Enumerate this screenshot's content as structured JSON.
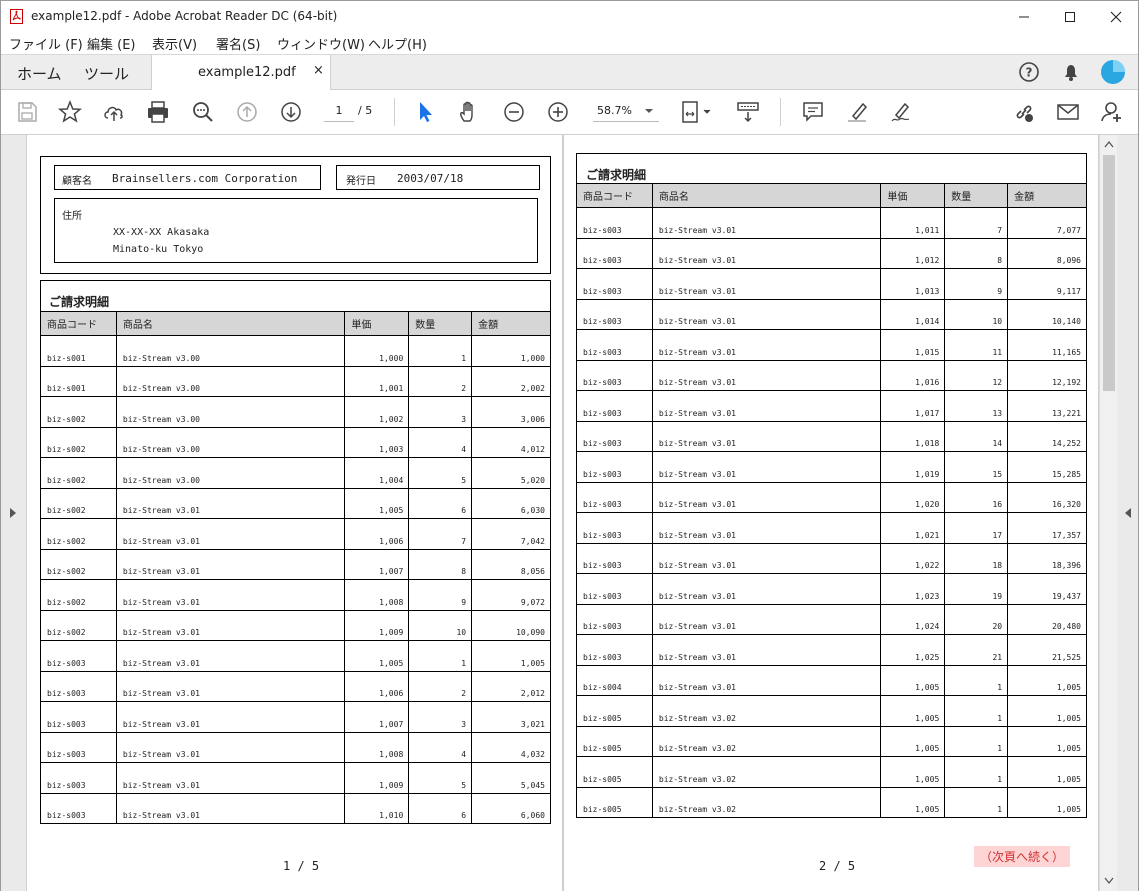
{
  "window": {
    "title": "example12.pdf - Adobe Acrobat Reader DC (64-bit)"
  },
  "menu": [
    "ファイル (F)",
    "編集 (E)",
    "表示(V)",
    "署名(S)",
    "ウィンドウ(W)",
    "ヘルプ(H)"
  ],
  "tabs": {
    "home": "ホーム",
    "tools": "ツール",
    "doc": "example12.pdf",
    "close": "×"
  },
  "toolbar": {
    "page_current": "1",
    "page_total": "/ 5",
    "zoom": "58.7%"
  },
  "page1": {
    "customer_label": "顧客名",
    "customer_value": "Brainsellers.com Corporation",
    "date_label": "発行日",
    "date_value": "2003/07/18",
    "address_label": "住所",
    "address_line1": "XX-XX-XX Akasaka",
    "address_line2": "Minato-ku Tokyo",
    "section_title": "ご請求明細",
    "headers": [
      "商品コード",
      "商品名",
      "単価",
      "数量",
      "金額"
    ],
    "rows": [
      [
        "biz-s001",
        "biz-Stream v3.00",
        "1,000",
        "1",
        "1,000"
      ],
      [
        "biz-s001",
        "biz-Stream v3.00",
        "1,001",
        "2",
        "2,002"
      ],
      [
        "biz-s002",
        "biz-Stream v3.00",
        "1,002",
        "3",
        "3,006"
      ],
      [
        "biz-s002",
        "biz-Stream v3.00",
        "1,003",
        "4",
        "4,012"
      ],
      [
        "biz-s002",
        "biz-Stream v3.00",
        "1,004",
        "5",
        "5,020"
      ],
      [
        "biz-s002",
        "biz-Stream v3.01",
        "1,005",
        "6",
        "6,030"
      ],
      [
        "biz-s002",
        "biz-Stream v3.01",
        "1,006",
        "7",
        "7,042"
      ],
      [
        "biz-s002",
        "biz-Stream v3.01",
        "1,007",
        "8",
        "8,056"
      ],
      [
        "biz-s002",
        "biz-Stream v3.01",
        "1,008",
        "9",
        "9,072"
      ],
      [
        "biz-s002",
        "biz-Stream v3.01",
        "1,009",
        "10",
        "10,090"
      ],
      [
        "biz-s003",
        "biz-Stream v3.01",
        "1,005",
        "1",
        "1,005"
      ],
      [
        "biz-s003",
        "biz-Stream v3.01",
        "1,006",
        "2",
        "2,012"
      ],
      [
        "biz-s003",
        "biz-Stream v3.01",
        "1,007",
        "3",
        "3,021"
      ],
      [
        "biz-s003",
        "biz-Stream v3.01",
        "1,008",
        "4",
        "4,032"
      ],
      [
        "biz-s003",
        "biz-Stream v3.01",
        "1,009",
        "5",
        "5,045"
      ],
      [
        "biz-s003",
        "biz-Stream v3.01",
        "1,010",
        "6",
        "6,060"
      ]
    ],
    "page_number": "1 / 5"
  },
  "page2": {
    "section_title": "ご請求明細",
    "headers": [
      "商品コード",
      "商品名",
      "単価",
      "数量",
      "金額"
    ],
    "rows": [
      [
        "biz-s003",
        "biz-Stream v3.01",
        "1,011",
        "7",
        "7,077"
      ],
      [
        "biz-s003",
        "biz-Stream v3.01",
        "1,012",
        "8",
        "8,096"
      ],
      [
        "biz-s003",
        "biz-Stream v3.01",
        "1,013",
        "9",
        "9,117"
      ],
      [
        "biz-s003",
        "biz-Stream v3.01",
        "1,014",
        "10",
        "10,140"
      ],
      [
        "biz-s003",
        "biz-Stream v3.01",
        "1,015",
        "11",
        "11,165"
      ],
      [
        "biz-s003",
        "biz-Stream v3.01",
        "1,016",
        "12",
        "12,192"
      ],
      [
        "biz-s003",
        "biz-Stream v3.01",
        "1,017",
        "13",
        "13,221"
      ],
      [
        "biz-s003",
        "biz-Stream v3.01",
        "1,018",
        "14",
        "14,252"
      ],
      [
        "biz-s003",
        "biz-Stream v3.01",
        "1,019",
        "15",
        "15,285"
      ],
      [
        "biz-s003",
        "biz-Stream v3.01",
        "1,020",
        "16",
        "16,320"
      ],
      [
        "biz-s003",
        "biz-Stream v3.01",
        "1,021",
        "17",
        "17,357"
      ],
      [
        "biz-s003",
        "biz-Stream v3.01",
        "1,022",
        "18",
        "18,396"
      ],
      [
        "biz-s003",
        "biz-Stream v3.01",
        "1,023",
        "19",
        "19,437"
      ],
      [
        "biz-s003",
        "biz-Stream v3.01",
        "1,024",
        "20",
        "20,480"
      ],
      [
        "biz-s003",
        "biz-Stream v3.01",
        "1,025",
        "21",
        "21,525"
      ],
      [
        "biz-s004",
        "biz-Stream v3.01",
        "1,005",
        "1",
        "1,005"
      ],
      [
        "biz-s005",
        "biz-Stream v3.02",
        "1,005",
        "1",
        "1,005"
      ],
      [
        "biz-s005",
        "biz-Stream v3.02",
        "1,005",
        "1",
        "1,005"
      ],
      [
        "biz-s005",
        "biz-Stream v3.02",
        "1,005",
        "1",
        "1,005"
      ],
      [
        "biz-s005",
        "biz-Stream v3.02",
        "1,005",
        "1",
        "1,005"
      ]
    ],
    "page_number": "2 / 5",
    "continued": "（次頁へ続く）"
  }
}
